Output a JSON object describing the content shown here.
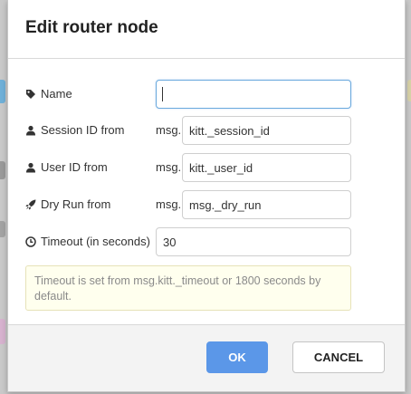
{
  "dialog": {
    "title": "Edit router node"
  },
  "fields": {
    "name": {
      "label": "Name",
      "icon": "tag-icon",
      "value": ""
    },
    "session_id": {
      "label": "Session ID from",
      "icon": "user-icon",
      "prefix": "msg.",
      "value": "kitt._session_id"
    },
    "user_id": {
      "label": "User ID from",
      "icon": "user-icon",
      "prefix": "msg.",
      "value": "kitt._user_id"
    },
    "dry_run": {
      "label": "Dry Run from",
      "icon": "rocket-icon",
      "prefix": "msg.",
      "value": "msg._dry_run"
    },
    "timeout": {
      "label": "Timeout (in seconds)",
      "icon": "clock-icon",
      "value": "30"
    }
  },
  "tip": {
    "text": "Timeout is set from msg.kitt._timeout or 1800 seconds by default."
  },
  "buttons": {
    "ok": "OK",
    "cancel": "CANCEL"
  },
  "colors": {
    "primary": "#5b97e8",
    "focus_border": "#6aa9dd",
    "tip_background": "#ffffee",
    "tip_text": "#8a8a8a"
  }
}
